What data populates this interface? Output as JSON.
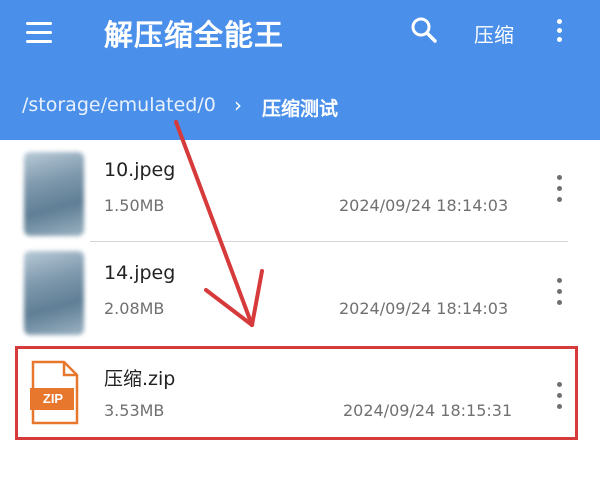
{
  "app": {
    "title": "解压缩全能王",
    "compress_label": "压缩",
    "menu_icon": "hamburger-menu-icon",
    "search_icon": "search-icon",
    "more_icon": "more-vertical-icon"
  },
  "breadcrumb": {
    "path": "/storage/emulated/0",
    "separator": "›",
    "current": "压缩测试"
  },
  "files": [
    {
      "name": "10.jpeg",
      "size": "1.50MB",
      "date": "2024/09/24 18:14:03",
      "icon": "image-thumbnail"
    },
    {
      "name": "14.jpeg",
      "size": "2.08MB",
      "date": "2024/09/24 18:14:03",
      "icon": "image-thumbnail"
    },
    {
      "name": "压缩.zip",
      "size": "3.53MB",
      "date": "2024/09/24 18:15:31",
      "icon": "zip-file-icon",
      "badge": "ZIP"
    }
  ],
  "colors": {
    "appbar": "#4a8fe9",
    "highlight": "#d63a3a",
    "zip_icon": "#e8772e"
  }
}
